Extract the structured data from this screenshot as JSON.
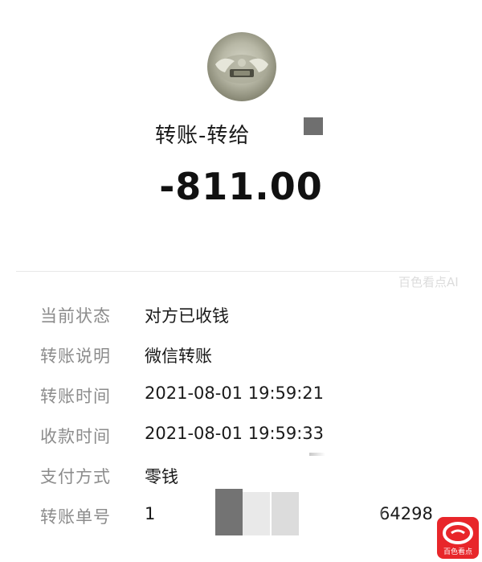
{
  "header": {
    "title": "转账-转给",
    "amount": "-811.00"
  },
  "details": [
    {
      "label": "当前状态",
      "value": "对方已收钱"
    },
    {
      "label": "转账说明",
      "value": "微信转账"
    },
    {
      "label": "转账时间",
      "value": "2021-08-01 19:59:21"
    },
    {
      "label": "收款时间",
      "value": "2021-08-01 19:59:33"
    },
    {
      "label": "支付方式",
      "value": "零钱"
    },
    {
      "label": "转账单号",
      "value": "1",
      "value_tail": "64298"
    }
  ],
  "watermark": {
    "text": "百色看点AI",
    "brand_text": "百色看点",
    "brand_color": "#e8262a"
  }
}
